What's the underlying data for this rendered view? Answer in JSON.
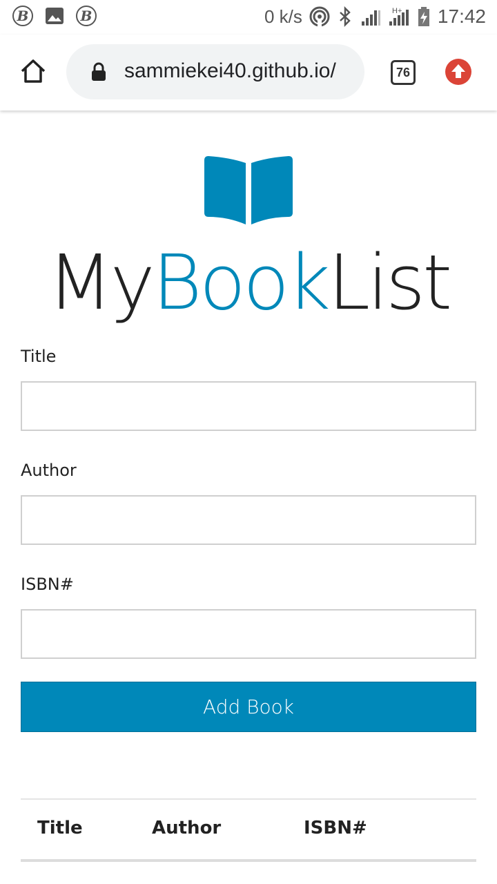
{
  "status_bar": {
    "left_icons": [
      "b-circle-icon",
      "image-icon",
      "b-circle-icon"
    ],
    "left_icon_glyph": "B",
    "net_speed": "0 k/s",
    "right_icons": [
      "hotspot-icon",
      "bluetooth-icon",
      "signal-icon",
      "signal-h-plus-icon",
      "battery-charging-icon"
    ],
    "network_type": "H+",
    "time": "17:42"
  },
  "browser": {
    "url": "sammiekei40.github.io/",
    "tab_count": "76",
    "accent_update_color": "#db4437"
  },
  "app": {
    "logo_icon": "open-book-icon",
    "brand_part1": "My",
    "brand_part2": "Book",
    "brand_part3": "List",
    "accent_color": "#0088b9"
  },
  "form": {
    "title_label": "Title",
    "title_value": "",
    "author_label": "Author",
    "author_value": "",
    "isbn_label": "ISBN#",
    "isbn_value": "",
    "submit_label": "Add Book"
  },
  "table": {
    "columns": [
      "Title",
      "Author",
      "ISBN#"
    ],
    "rows": []
  }
}
